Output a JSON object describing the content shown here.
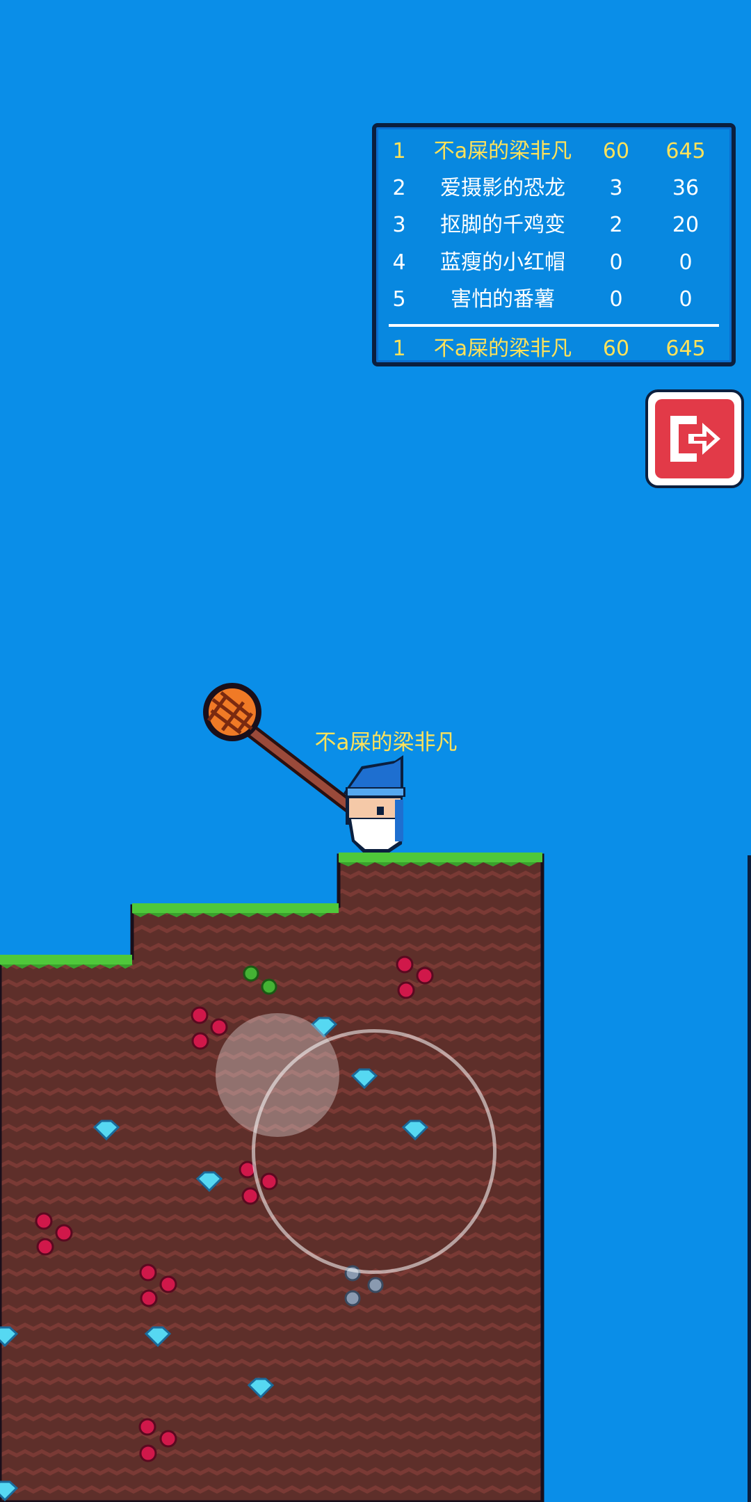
{
  "leaderboard": {
    "rows": [
      {
        "rank": "1",
        "name": "不a屎的梁非凡",
        "a": "60",
        "b": "645"
      },
      {
        "rank": "2",
        "name": "爱摄影的恐龙",
        "a": "3",
        "b": "36"
      },
      {
        "rank": "3",
        "name": "抠脚的千鸡变",
        "a": "2",
        "b": "20"
      },
      {
        "rank": "4",
        "name": "蓝瘦的小红帽",
        "a": "0",
        "b": "0"
      },
      {
        "rank": "5",
        "name": "害怕的番薯",
        "a": "0",
        "b": "0"
      }
    ],
    "self": {
      "rank": "1",
      "name": "不a屎的梁非凡",
      "a": "60",
      "b": "645"
    }
  },
  "player": {
    "name": "不a屎的梁非凡"
  },
  "icons": {
    "exit": "exit-door-icon",
    "hammer": "hammer-icon",
    "wizard": "wizard-player-icon"
  },
  "colors": {
    "sky": "#0a8ee8",
    "dirt": "#5e2f2a",
    "grass": "#4fc83a",
    "highlight_text": "#ffe25a",
    "exit_button": "#e23a48",
    "gem_red": "#d0184a",
    "gem_cyan": "#56d8f2",
    "gem_green": "#44b234",
    "gem_gray": "#8a9ab0"
  }
}
